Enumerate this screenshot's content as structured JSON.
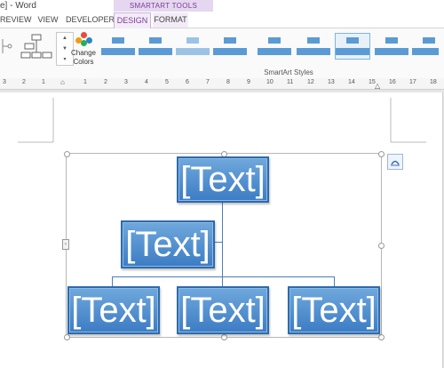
{
  "window": {
    "title": "e] - Word",
    "context_tools": "SMARTART TOOLS"
  },
  "tabs": [
    {
      "label": "REVIEW"
    },
    {
      "label": "VIEW"
    },
    {
      "label": "DEVELOPER"
    },
    {
      "label": "DESIGN"
    },
    {
      "label": "FORMAT"
    }
  ],
  "ribbon": {
    "change_colors_label": "Change Colors",
    "group_label": "SmartArt Styles"
  },
  "ruler": {
    "numbers": [
      "3",
      "2",
      "1",
      "1",
      "2",
      "3",
      "4",
      "5",
      "6",
      "7",
      "8",
      "9",
      "10",
      "11",
      "12",
      "13",
      "14",
      "15",
      "16",
      "17",
      "18"
    ]
  },
  "smartart": {
    "nodes": [
      {
        "text": "[Text]"
      },
      {
        "text": "[Text]"
      },
      {
        "text": "[Text]"
      },
      {
        "text": "[Text]"
      },
      {
        "text": "[Text]"
      }
    ]
  },
  "colors": {
    "accent": "#5b9bd5",
    "box": "#4a8bd0",
    "context": "#7b3a9a"
  }
}
